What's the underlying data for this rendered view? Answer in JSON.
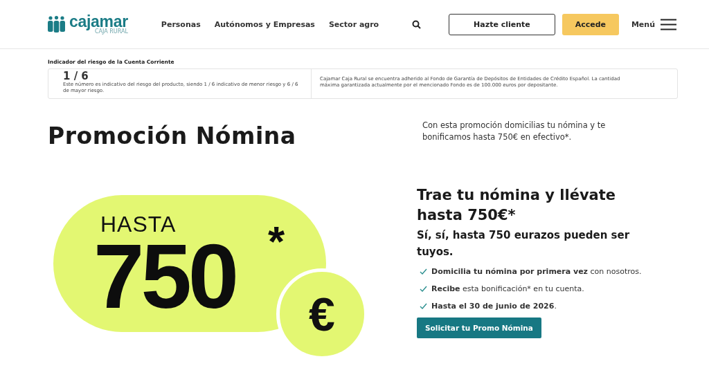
{
  "header": {
    "logo": {
      "name": "cajamar",
      "subtitle": "CAJA RURAL"
    },
    "nav": [
      {
        "label": "Personas"
      },
      {
        "label": "Autónomos y Empresas"
      },
      {
        "label": "Sector agro"
      }
    ],
    "buttons": [
      {
        "kind": "outline",
        "label": "Hazte cliente"
      },
      {
        "kind": "filled",
        "label": "Accede"
      }
    ],
    "menu_label": "Menú"
  },
  "risk": {
    "title": "Indicador del riesgo de la Cuenta Corriente",
    "score": "1 / 6",
    "description": "Este número es indicativo del riesgo del producto, siendo 1 / 6 indicativo de menor riesgo y 6 / 6 de mayor riesgo.",
    "guarantee": "Cajamar Caja Rural se encuentra adherido al Fondo de Garantía de Depósitos de Entidades de Crédito Español. La cantidad máxima garantizada actualmente por el mencionado Fondo es de 100.000 euros por depositante."
  },
  "page_title": "Promoción Nómina",
  "intro": "Con esta promoción domicilias tu nómina y te bonificamos hasta 750€ en efectivo*.",
  "promo_graphic": {
    "prefix": "HASTA",
    "amount": "750",
    "asterisk": "*",
    "currency": "€"
  },
  "offer": {
    "heading": "Trae tu nómina y llévate hasta 750€*",
    "subheading": "Sí, sí, hasta 750 eurazos pueden ser tuyos.",
    "bullets": [
      "**Domicilia tu nómina por primera vez** con nosotros.",
      "**Recibe** esta bonificación* en tu cuenta.",
      "**Hasta el 30 de junio de 2026**."
    ],
    "cta": "Solicitar tu Promo Nómina"
  }
}
